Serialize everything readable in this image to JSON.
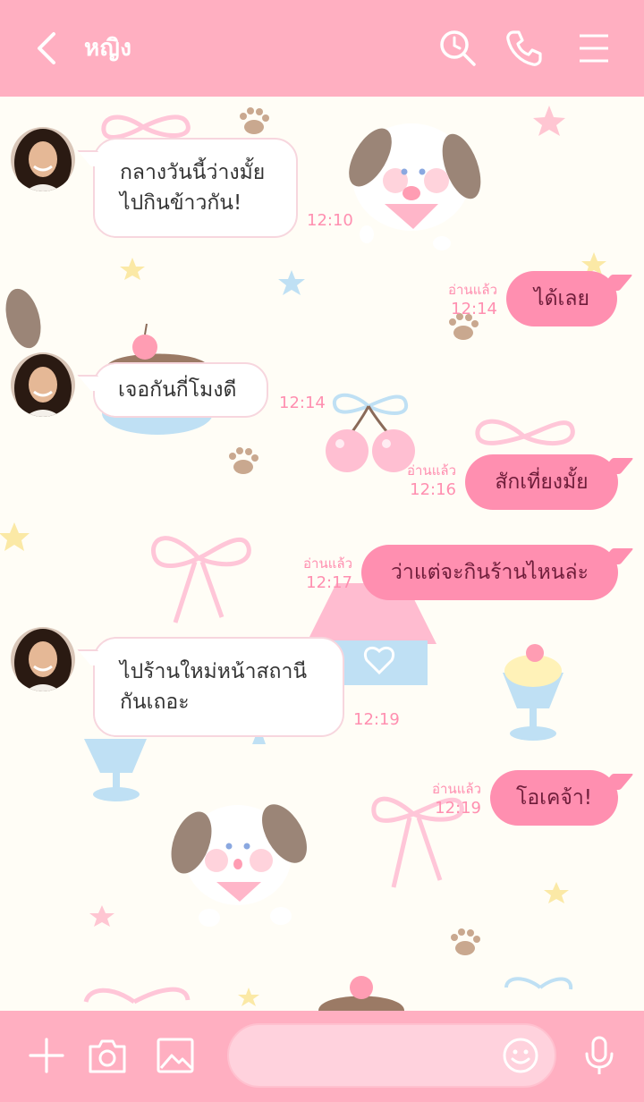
{
  "header": {
    "contact_name": "หญิง",
    "icons": [
      "back-chevron-icon",
      "search-history-icon",
      "phone-icon",
      "menu-icon"
    ]
  },
  "colors": {
    "header": "#ffafc1",
    "background": "#fffdf6",
    "outgoing_bubble": "#ff8fb0",
    "outgoing_text": "#6e1d3a",
    "incoming_bubble": "#ffffff",
    "timestamp": "#ff8fb0"
  },
  "messages": [
    {
      "from": "contact",
      "lines": [
        "กลางวันนี้ว่างมั้ย",
        "ไปกินข้าวกัน!"
      ],
      "time": "12:10"
    },
    {
      "from": "me",
      "text": "ได้เลย",
      "read": "อ่านแล้ว",
      "time": "12:14"
    },
    {
      "from": "contact",
      "lines": [
        "เจอกันกี่โมงดี"
      ],
      "time": "12:14"
    },
    {
      "from": "me",
      "text": "สักเที่ยงมั้ย",
      "read": "อ่านแล้ว",
      "time": "12:16"
    },
    {
      "from": "me",
      "text": "ว่าแต่จะกินร้านไหนล่ะ",
      "read": "อ่านแล้ว",
      "time": "12:17"
    },
    {
      "from": "contact",
      "lines": [
        "ไปร้านใหม่หน้าสถานี",
        "กันเถอะ"
      ],
      "time": "12:19"
    },
    {
      "from": "me",
      "text": "โอเคจ้า!",
      "read": "อ่านแล้ว",
      "time": "12:19"
    }
  ],
  "composer": {
    "input_value": "",
    "placeholder": "",
    "icons": [
      "plus-icon",
      "camera-icon",
      "image-icon",
      "emoji-icon",
      "microphone-icon"
    ]
  }
}
